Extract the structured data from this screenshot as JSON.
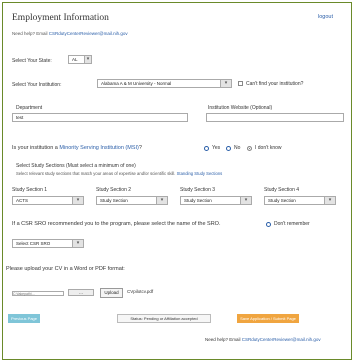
{
  "header": {
    "title": "Employment Information",
    "top_link": "logout"
  },
  "help_line": {
    "prefix": "Need help? Email ",
    "email": "CSRdutyCenterReviewer@mail.nih.gov"
  },
  "state": {
    "label": "Select Your State:",
    "value": "AL"
  },
  "institution": {
    "label": "Select Your Institution:",
    "value": "Alabama A & M University - Normal",
    "cant_find_link": "Can't find your institution?"
  },
  "department": {
    "label": "Department",
    "value": "test"
  },
  "website": {
    "label": "Institution Website (Optional)",
    "value": ""
  },
  "msi": {
    "question_prefix": "Is your institution a ",
    "question_link": "Minority Serving Institution (MSI)",
    "question_suffix": "?",
    "options": [
      "Yes",
      "No",
      "I don't know"
    ],
    "selected_index": 2
  },
  "study_sections": {
    "heading": "Select Study Sections (Must select a minimum of one)",
    "subtext_prefix": "Select relevant study sections that match your areas of expertise and/or scientific skill. ",
    "subtext_link": "Standing Study Sections",
    "columns": [
      {
        "label": "Study Section 1",
        "value": "ACTS"
      },
      {
        "label": "Study Section 2",
        "value": "Study Section"
      },
      {
        "label": "Study Section 3",
        "value": "Study Section"
      },
      {
        "label": "Study Section 4",
        "value": "Study Section"
      }
    ]
  },
  "sro": {
    "question": "If a CSR SRO recommended you to the program, please select the name of the SRO.",
    "dont_remember": "Don't remember",
    "select_value": "Select CSR SRO"
  },
  "cv": {
    "label": "Please upload your CV in a Word or PDF format:",
    "file_path": "C:\\fakepath\\...",
    "browse_label": "...",
    "upload_label": "Upload",
    "uploaded_file": "CVpilotcv.pdf"
  },
  "actions": {
    "back_label": "Previous Page",
    "status_text": "Status: Pending or Affiliation accepted",
    "save_label": "Save Application / Submit Page",
    "footer_prefix": "Need help? Email ",
    "footer_email": "CSRdutyCenterReviewer@mail.nih.gov"
  },
  "colors": {
    "border": "#6a8a2a",
    "link": "#2a5ea8",
    "back_button": "#7fc5d8",
    "save_button": "#f0a540",
    "radio_ring": "#2a5ea8"
  }
}
